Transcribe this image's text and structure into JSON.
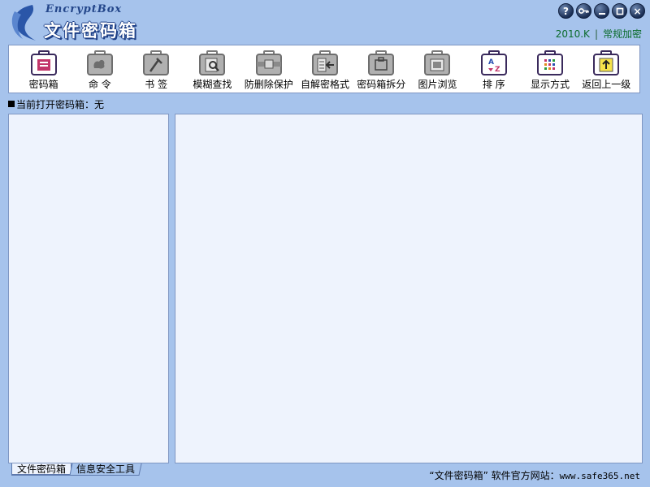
{
  "header": {
    "logo_en": "EncryptBox",
    "logo_cn": "文件密码箱",
    "version": "2010.K",
    "separator": "|",
    "mode": "常规加密",
    "window_buttons": [
      {
        "icon": "help-icon",
        "glyph": "?"
      },
      {
        "icon": "key-icon",
        "glyph": ""
      },
      {
        "icon": "minimize-icon",
        "glyph": ""
      },
      {
        "icon": "maximize-icon",
        "glyph": ""
      },
      {
        "icon": "close-icon",
        "glyph": "×"
      }
    ]
  },
  "toolbar": {
    "items": [
      {
        "label": "密码箱",
        "icon": "password-box-icon",
        "active": true
      },
      {
        "label": "命  令",
        "icon": "command-icon",
        "active": false
      },
      {
        "label": "书  签",
        "icon": "bookmark-icon",
        "active": false
      },
      {
        "label": "模糊查找",
        "icon": "fuzzy-search-icon",
        "active": false
      },
      {
        "label": "防删除保护",
        "icon": "delete-protect-icon",
        "active": false
      },
      {
        "label": "自解密格式",
        "icon": "self-decrypt-icon",
        "active": false
      },
      {
        "label": "密码箱拆分",
        "icon": "split-box-icon",
        "active": false
      },
      {
        "label": "图片浏览",
        "icon": "image-browse-icon",
        "active": false
      },
      {
        "label": "排  序",
        "icon": "sort-icon",
        "active": true
      },
      {
        "label": "显示方式",
        "icon": "display-mode-icon",
        "active": true
      },
      {
        "label": "返回上一级",
        "icon": "go-up-icon",
        "active": true
      }
    ]
  },
  "status": {
    "current_box": "当前打开密码箱：无"
  },
  "tabs": [
    {
      "label": "文件密码箱",
      "active": true
    },
    {
      "label": "信息安全工具",
      "active": false
    }
  ],
  "footer": {
    "site_label": "“文件密码箱” 软件官方网站：",
    "site_url": "www.safe365.net"
  },
  "colors": {
    "background": "#a6c3ec",
    "panel": "#eef3fd",
    "border": "#7f96c2",
    "active_icon": "#5b3a86",
    "inactive_icon": "#8a8a8a",
    "version_text": "#0a6b2b"
  }
}
